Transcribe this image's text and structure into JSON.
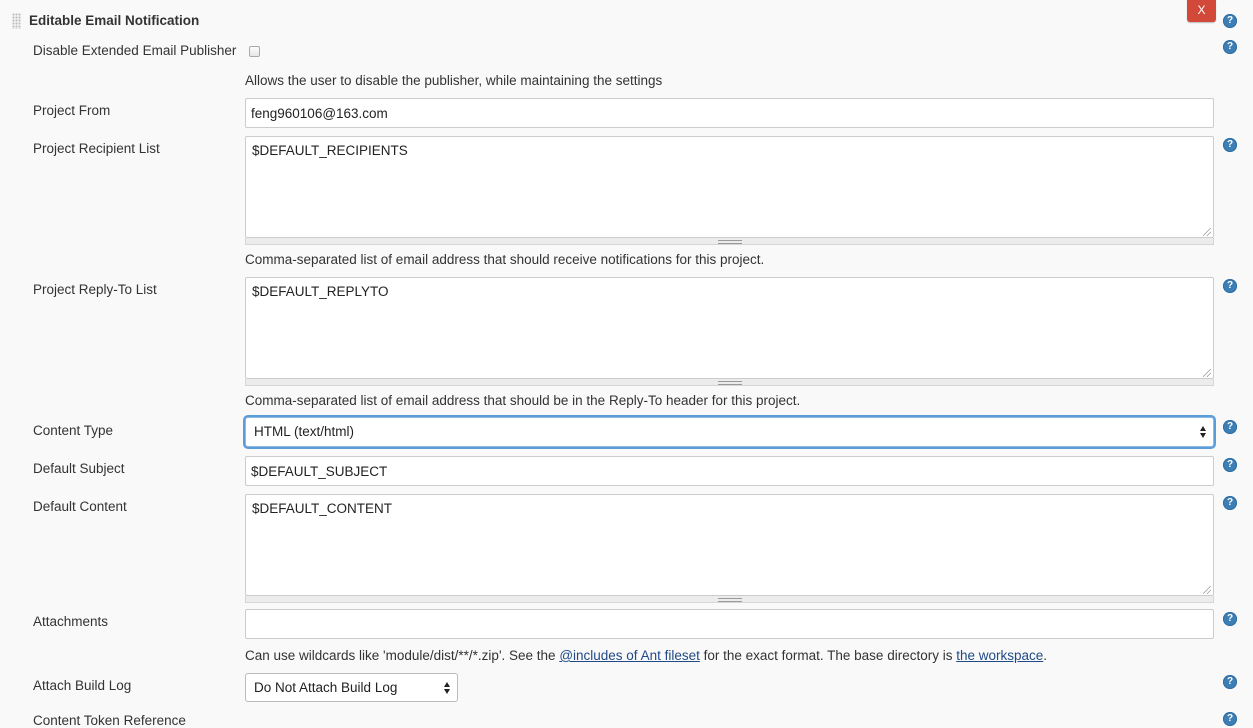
{
  "section": {
    "title": "Editable Email Notification",
    "delete_label": "X",
    "help_glyph": "?"
  },
  "disable_publisher": {
    "label": "Disable Extended Email Publisher",
    "checked": false,
    "description": "Allows the user to disable the publisher, while maintaining the settings"
  },
  "project_from": {
    "label": "Project From",
    "value": "feng960106@163.com"
  },
  "recipient_list": {
    "label": "Project Recipient List",
    "value": "$DEFAULT_RECIPIENTS",
    "description": "Comma-separated list of email address that should receive notifications for this project."
  },
  "reply_to_list": {
    "label": "Project Reply-To List",
    "value": "$DEFAULT_REPLYTO",
    "description": "Comma-separated list of email address that should be in the Reply-To header for this project."
  },
  "content_type": {
    "label": "Content Type",
    "selected": "HTML (text/html)"
  },
  "default_subject": {
    "label": "Default Subject",
    "value": "$DEFAULT_SUBJECT"
  },
  "default_content": {
    "label": "Default Content",
    "value": "$DEFAULT_CONTENT"
  },
  "attachments": {
    "label": "Attachments",
    "value": "",
    "desc_prefix": "Can use wildcards like 'module/dist/**/*.zip'. See the ",
    "desc_link1": "@includes of Ant fileset",
    "desc_middle": " for the exact format. The base directory is ",
    "desc_link2": "the workspace",
    "desc_suffix": "."
  },
  "attach_build_log": {
    "label": "Attach Build Log",
    "selected": "Do Not Attach Build Log"
  },
  "content_token_reference": {
    "label": "Content Token Reference"
  },
  "colors": {
    "background": "#f9f9f9",
    "delete_button": "#d24939",
    "help_icon": "#3d7fb5",
    "focus_ring": "#5b9dd9",
    "link": "#204a87"
  }
}
